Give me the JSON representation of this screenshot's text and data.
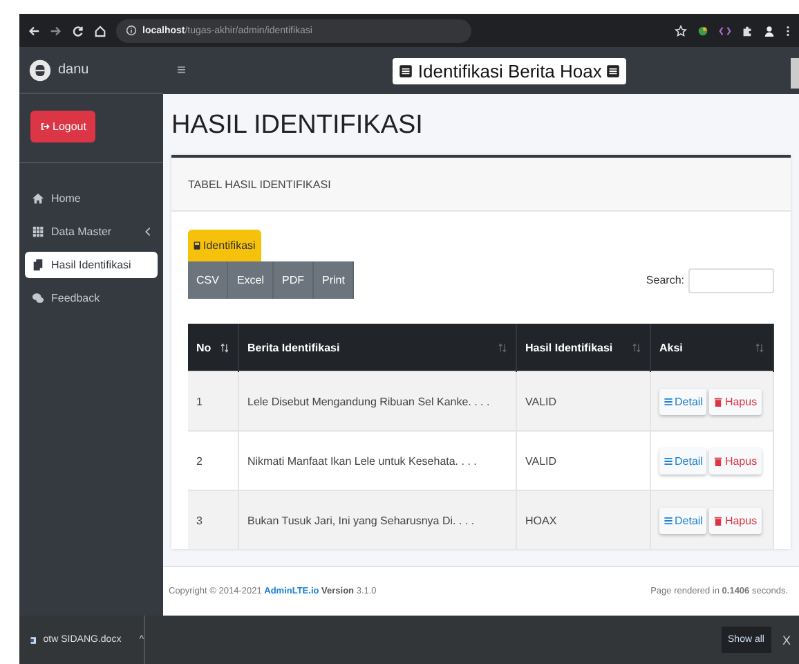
{
  "browser": {
    "url_host": "localhost",
    "url_path": "/tugas-akhir/admin/identifikasi"
  },
  "sidebar": {
    "user": "danu",
    "logout": "Logout",
    "items": [
      {
        "kind": "home",
        "label": "Home",
        "selected": false,
        "has_submenu": false
      },
      {
        "kind": "grid",
        "label": "Data Master",
        "selected": false,
        "has_submenu": true
      },
      {
        "kind": "file",
        "label": "Hasil Identifikasi",
        "selected": true,
        "has_submenu": false
      },
      {
        "kind": "chat",
        "label": "Feedback",
        "selected": false,
        "has_submenu": false
      }
    ]
  },
  "header": {
    "menu_icon": "≡",
    "title": "Identifikasi Berita Hoax"
  },
  "page_title": "HASIL IDENTIFIKASI",
  "card": {
    "title": "TABEL HASIL IDENTIFIKASI",
    "identify_button": "Identifikasi",
    "export_buttons": [
      "CSV",
      "Excel",
      "PDF",
      "Print"
    ],
    "search_label": "Search:",
    "columns": [
      "No",
      "Berita Identifikasi",
      "Hasil Identifikasi",
      "Aksi"
    ],
    "rows": [
      {
        "no": "1",
        "title": "Lele Disebut Mengandung Ribuan Sel Kanke. . . .",
        "result": "VALID",
        "detail": "Detail",
        "delete": "Hapus"
      },
      {
        "no": "2",
        "title": "Nikmati Manfaat Ikan Lele untuk Kesehata. . . .",
        "result": "VALID",
        "detail": "Detail",
        "delete": "Hapus"
      },
      {
        "no": "3",
        "title": "Bukan Tusuk Jari, Ini yang Seharusnya Di. . . .",
        "result": "HOAX",
        "detail": "Detail",
        "delete": "Hapus"
      }
    ]
  },
  "footer": {
    "copyright": "Copyright © 2014-2021",
    "link": "AdminLTE.io",
    "version_label": "Version",
    "version": "3.1.0",
    "rendered": "Page rendered in **0.1406** seconds."
  },
  "download_bar": {
    "file": "otw SIDANG.docx",
    "caret": "^",
    "show_all": "Show all",
    "close": "X"
  }
}
